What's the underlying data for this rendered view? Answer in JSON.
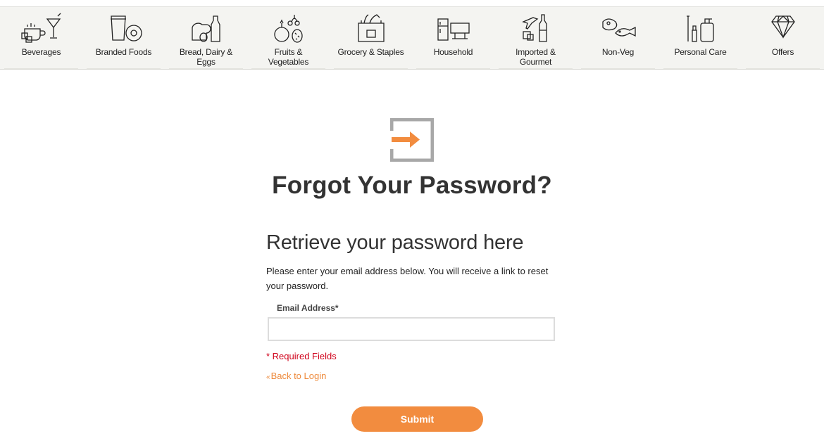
{
  "nav": {
    "categories": [
      {
        "label": "Beverages",
        "icon": "beverages-icon"
      },
      {
        "label": "Branded Foods",
        "icon": "branded-foods-icon"
      },
      {
        "label": "Bread, Dairy & Eggs",
        "icon": "bread-dairy-icon"
      },
      {
        "label": "Fruits & Vegetables",
        "icon": "fruits-vegetables-icon"
      },
      {
        "label": "Grocery & Staples",
        "icon": "grocery-bag-icon"
      },
      {
        "label": "Household",
        "icon": "household-appliances-icon"
      },
      {
        "label": "Imported & Gourmet",
        "icon": "imported-gourmet-icon"
      },
      {
        "label": "Non-Veg",
        "icon": "meat-fish-icon"
      },
      {
        "label": "Personal Care",
        "icon": "personal-care-icon"
      },
      {
        "label": "Offers",
        "icon": "diamond-icon"
      }
    ]
  },
  "page": {
    "title": "Forgot Your Password?",
    "subtitle": "Retrieve your password here",
    "description": "Please enter your email address below. You will receive a link to reset your password.",
    "email_label": "Email Address*",
    "email_value": "",
    "required_note": "* Required Fields",
    "back_link": "Back to Login",
    "back_link_prefix": "«",
    "submit_label": "Submit"
  },
  "colors": {
    "accent": "#f28c3f",
    "required": "#d0021b",
    "icon_gray": "#a8a8a8"
  }
}
